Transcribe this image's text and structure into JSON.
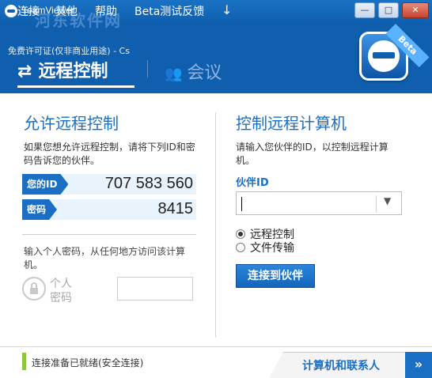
{
  "window": {
    "title": "TeamViewer",
    "min_label": "—",
    "max_label": "□",
    "close_label": "✕"
  },
  "menu": {
    "items": [
      "连接",
      "其他",
      "帮助",
      "Beta测试反馈"
    ],
    "download_icon": "↓"
  },
  "license_text": "免费许可证(仅非商业用途) - Cs",
  "watermark": "河东软件网",
  "tabs": {
    "remote": "远程控制",
    "meeting": "会议"
  },
  "beta_badge": "Beta",
  "left": {
    "title": "允许远程控制",
    "description": "如果您想允许远程控制，请将下列ID和密码告诉您的伙伴。",
    "id_label": "您的ID",
    "id_value": "707 583 560",
    "password_label": "密码",
    "password_value": "8415",
    "personal_description": "输入个人密码，从任何地方访问该计算机。",
    "personal_label": "个人密码"
  },
  "right": {
    "title": "控制远程计算机",
    "description": "请输入您伙伴的ID，以控制远程计算机。",
    "partner_id_label": "伙伴ID",
    "partner_id_value": "",
    "options": [
      "远程控制",
      "文件传输"
    ],
    "selected_option": "远程控制",
    "connect_button": "连接到伙伴"
  },
  "status": {
    "text": "连接准备已就绪(安全连接)",
    "color": "#8cc63f"
  },
  "footer": {
    "contacts_label": "计算机和联系人",
    "contacts_arrow": "»"
  },
  "colors": {
    "brand_blue": "#0f5fae",
    "accent_blue": "#1a6fc4",
    "ready_green": "#8cc63f"
  }
}
